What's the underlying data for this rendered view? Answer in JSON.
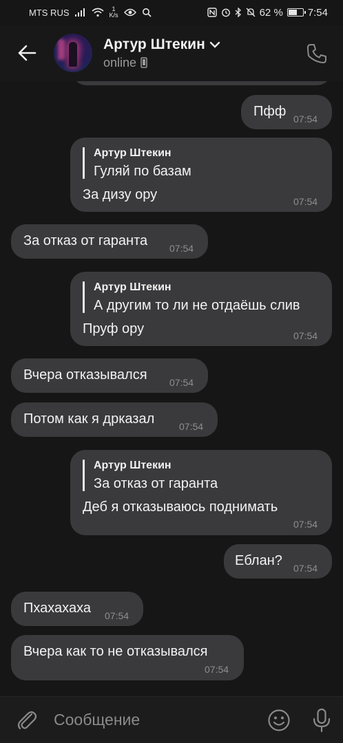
{
  "status_bar": {
    "carrier": "MTS RUS",
    "net_speed_value": "1",
    "net_speed_unit": "K/s",
    "battery_percent": "62 %",
    "battery_level": 0.62,
    "time": "7:54"
  },
  "header": {
    "contact_name": "Артур Штекин",
    "contact_status": "online"
  },
  "messages": [
    {
      "side": "out",
      "text": "Пфф",
      "time": "07:54"
    },
    {
      "side": "out",
      "reply_name": "Артур Штекин",
      "reply_text": "Гуляй по базам",
      "text": "За дизу ору",
      "time": "07:54"
    },
    {
      "side": "in",
      "text": "За отказ от гаранта",
      "time": "07:54"
    },
    {
      "side": "out",
      "reply_name": "Артур Штекин",
      "reply_text": "А другим то ли не отдаёшь слив",
      "text": "Пруф ору",
      "time": "07:54"
    },
    {
      "side": "in",
      "text": "Вчера отказывался",
      "time": "07:54"
    },
    {
      "side": "in",
      "text": "Потом как я дрказал",
      "time": "07:54"
    },
    {
      "side": "out",
      "reply_name": "Артур Штекин",
      "reply_text": "За отказ от гаранта",
      "text": "Деб я отказываюсь поднимать",
      "time": "07:54"
    },
    {
      "side": "out",
      "text": "Еблан?",
      "time": "07:54"
    },
    {
      "side": "in",
      "text": "Пхахахаха",
      "time": "07:54"
    },
    {
      "side": "in",
      "text": "Вчера как то не отказывался",
      "time": "07:54"
    }
  ],
  "composer": {
    "placeholder": "Сообщение"
  },
  "icons": {
    "back": "arrow-left-icon",
    "dropdown": "chevron-down-icon",
    "device": "phone-device-icon",
    "call": "phone-call-icon",
    "attach": "paperclip-icon",
    "emoji": "emoji-icon",
    "mic": "microphone-icon"
  },
  "colors": {
    "background": "#161616",
    "bubble": "#3a3a3c",
    "timestamp": "#8e8e90"
  }
}
